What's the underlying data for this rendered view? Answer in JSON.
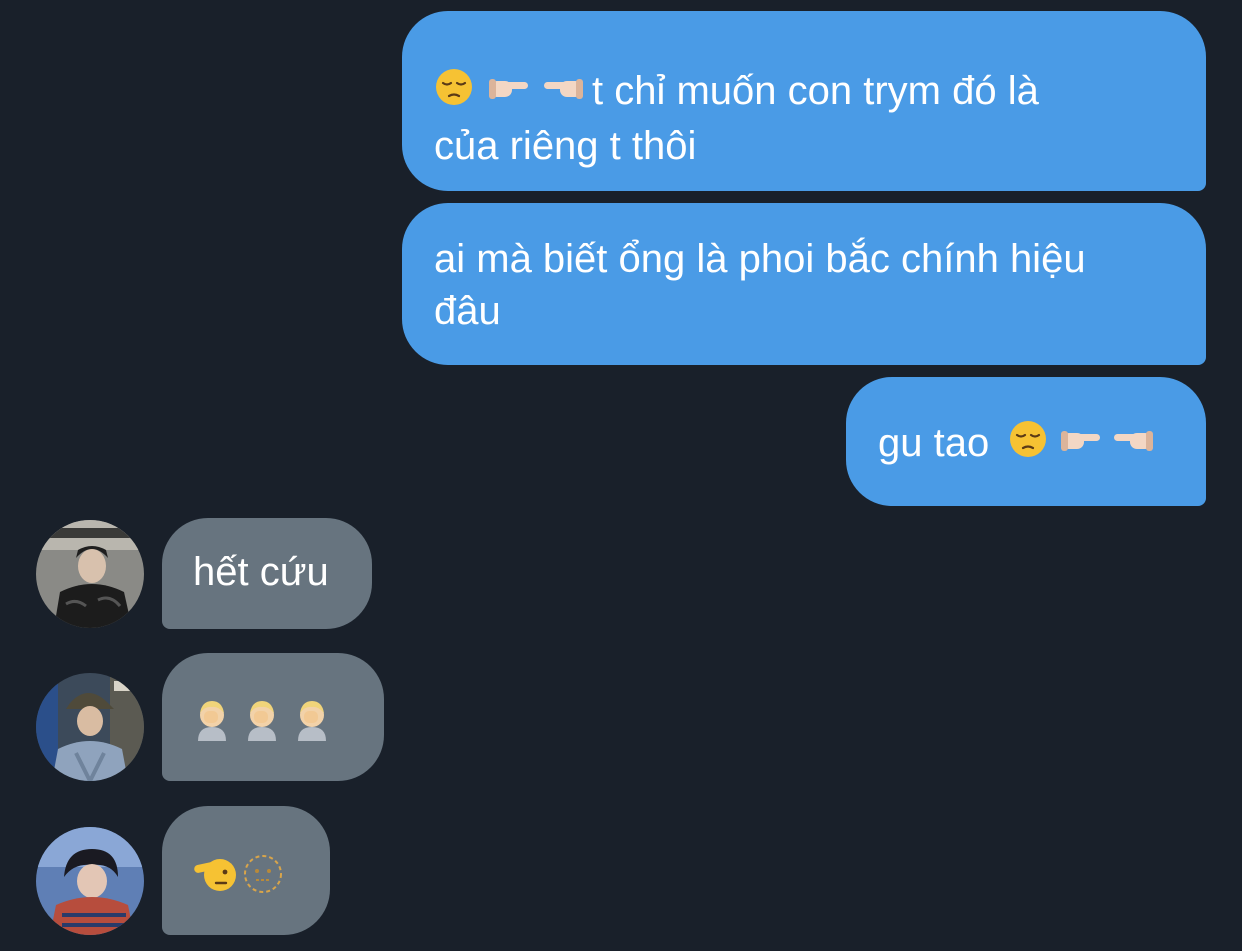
{
  "messages": [
    {
      "direction": "outgoing",
      "emojis_before": [
        "pensive-face",
        "backhand-index-pointing-right",
        "backhand-index-pointing-left"
      ],
      "text": "t chỉ muốn con trym đó là\ncủa riêng t thôi"
    },
    {
      "direction": "outgoing",
      "text": "ai mà biết ổng là phoi bắc chính hiệu\nđâu"
    },
    {
      "direction": "outgoing",
      "text": "gu tao",
      "emojis_after": [
        "pensive-face",
        "backhand-index-pointing-right",
        "backhand-index-pointing-left"
      ]
    },
    {
      "direction": "incoming",
      "sender_avatar": "avatar-photo",
      "text": "hết cứu"
    },
    {
      "direction": "incoming",
      "sender_avatar": "avatar-photo",
      "emojis": [
        "person-facepalming",
        "person-facepalming",
        "person-facepalming"
      ]
    },
    {
      "direction": "incoming",
      "sender_avatar": "avatar-photo",
      "emojis": [
        "saluting-face",
        "dotted-line-face"
      ]
    }
  ],
  "colors": {
    "background": "#19202a",
    "outgoing_bubble": "#4a9be6",
    "incoming_bubble": "#67747f",
    "text": "#ffffff"
  }
}
